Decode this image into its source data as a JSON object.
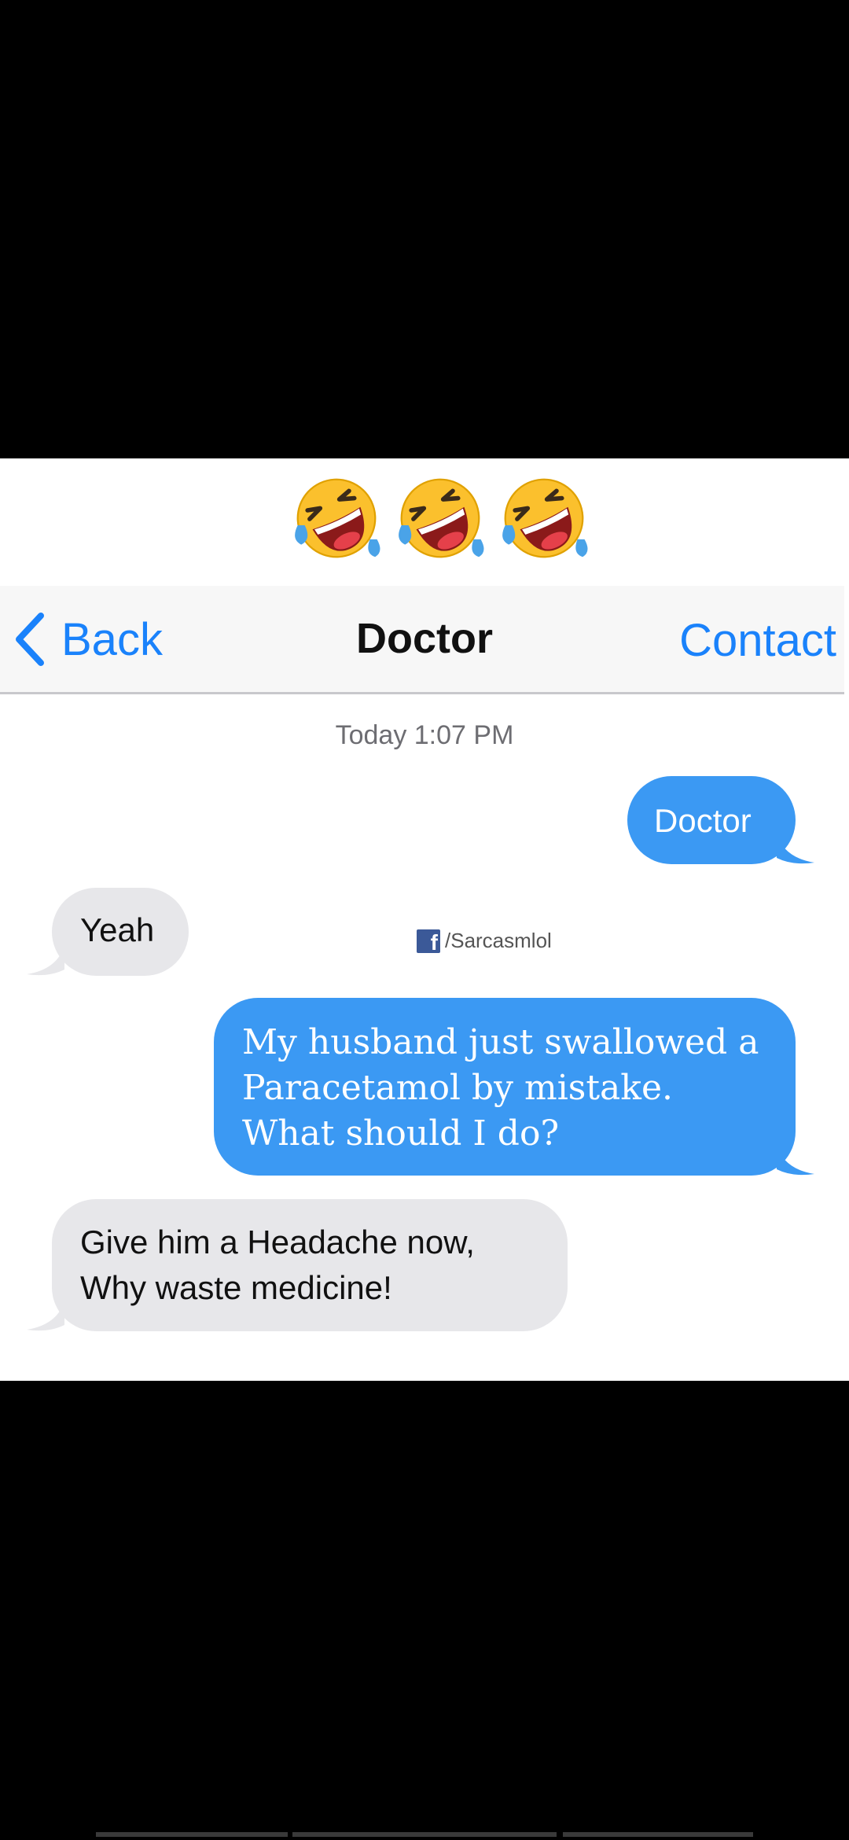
{
  "emojis": [
    {
      "icon": "rolling-on-floor-laughing-emoji"
    },
    {
      "icon": "rolling-on-floor-laughing-emoji"
    },
    {
      "icon": "rolling-on-floor-laughing-emoji"
    }
  ],
  "navbar": {
    "back_label": "Back",
    "title": "Doctor",
    "contact_label": "Contact",
    "back_icon": "chevron-left-icon",
    "accent": "#1a82fb"
  },
  "conversation": {
    "timestamp": "Today 1:07 PM",
    "messages": [
      {
        "direction": "outgoing",
        "text": "Doctor"
      },
      {
        "direction": "incoming",
        "text": "Yeah"
      },
      {
        "direction": "outgoing",
        "text": "My husband just swallowed a Paracetamol by mistake. What should I do?"
      },
      {
        "direction": "incoming",
        "text": "Give him a Headache now, Why waste medicine!"
      }
    ]
  },
  "watermark": {
    "icon": "facebook-icon",
    "icon_glyph": "f",
    "text": "/Sarcasmlol"
  },
  "colors": {
    "outgoing_bubble": "#3b99f3",
    "incoming_bubble": "#e7e7ea",
    "background": "#000000"
  }
}
